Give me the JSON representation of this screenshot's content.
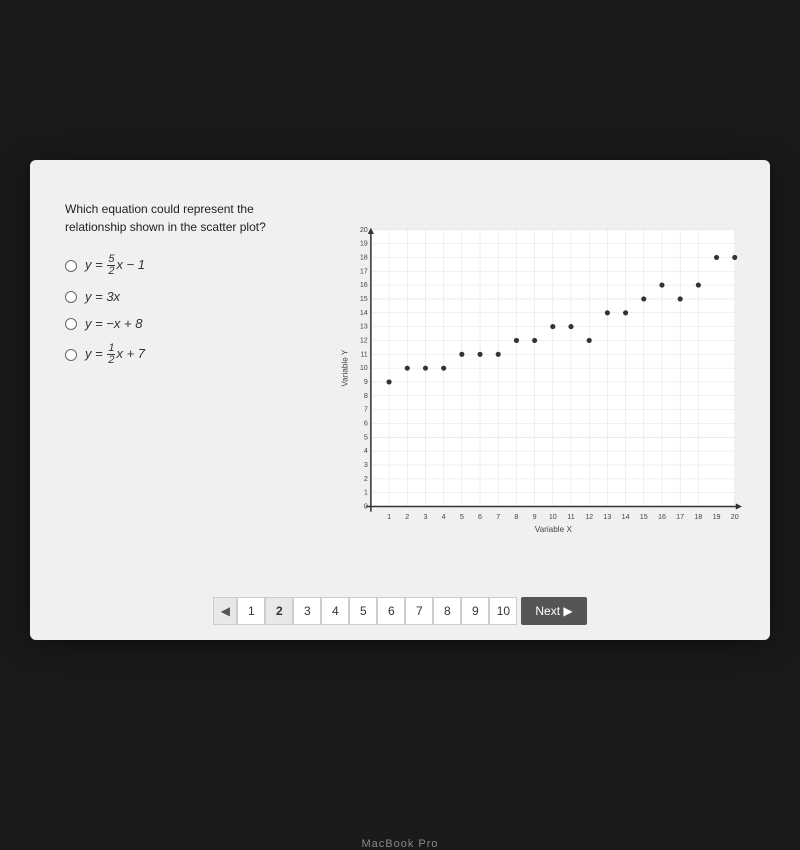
{
  "question": {
    "text": "Which equation could represent the relationship shown in the scatter plot?",
    "options": [
      {
        "id": "a",
        "label": "y = (5/2)x − 1",
        "latex": true
      },
      {
        "id": "b",
        "label": "y = 3x"
      },
      {
        "id": "c",
        "label": "y = −x + 8"
      },
      {
        "id": "d",
        "label": "y = (1/2)x + 7",
        "latex": true
      }
    ]
  },
  "chart": {
    "x_label": "Variable X",
    "y_label": "Variable Y",
    "x_max": 20,
    "y_max": 20,
    "points": [
      [
        1,
        9
      ],
      [
        2,
        10
      ],
      [
        3,
        10
      ],
      [
        4,
        10
      ],
      [
        5,
        11
      ],
      [
        6,
        11
      ],
      [
        7,
        11
      ],
      [
        8,
        12
      ],
      [
        9,
        12
      ],
      [
        10,
        13
      ],
      [
        11,
        13
      ],
      [
        12,
        12
      ],
      [
        13,
        14
      ],
      [
        14,
        14
      ],
      [
        15,
        15
      ],
      [
        16,
        16
      ],
      [
        17,
        15
      ],
      [
        18,
        16
      ],
      [
        19,
        18
      ],
      [
        20,
        18
      ]
    ]
  },
  "pagination": {
    "current": 2,
    "pages": [
      "1",
      "2",
      "3",
      "4",
      "5",
      "6",
      "7",
      "8",
      "9",
      "10"
    ],
    "next_label": "Next ▶"
  },
  "footer": {
    "brand": "MacBook Pro"
  }
}
